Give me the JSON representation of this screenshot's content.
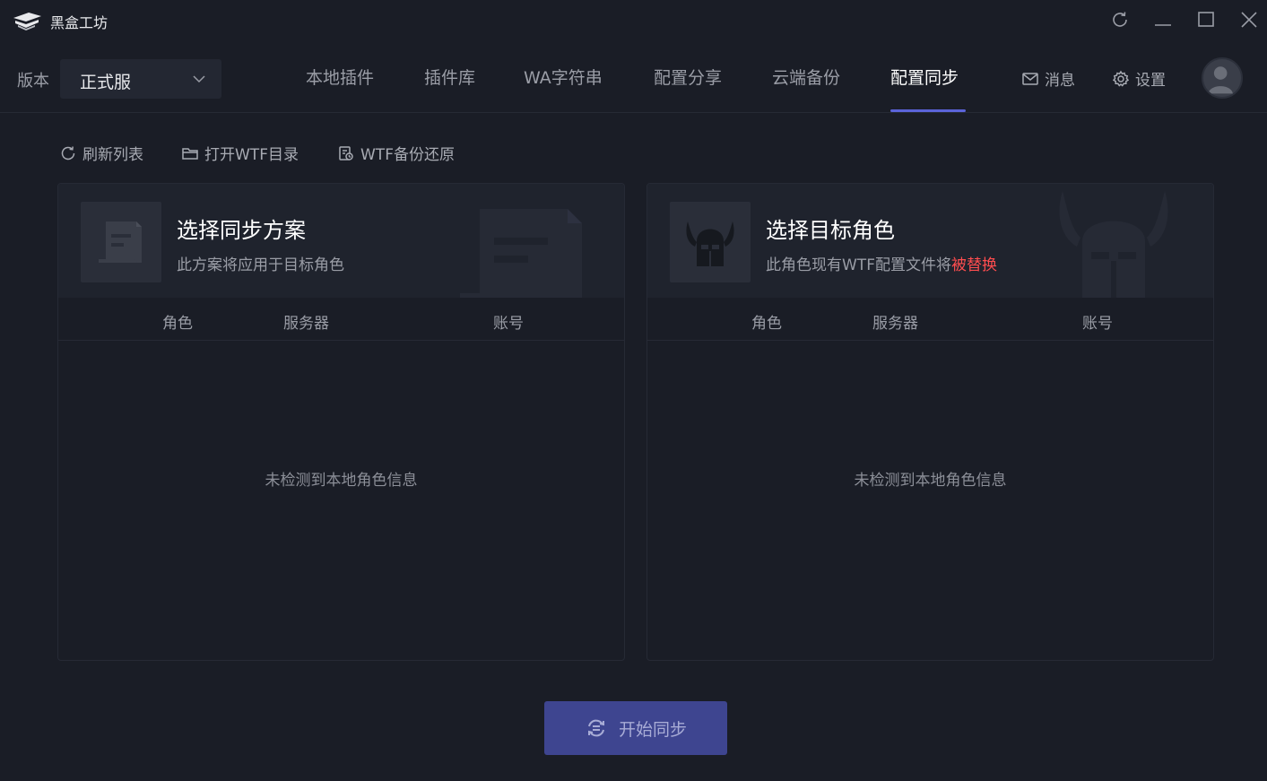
{
  "app": {
    "title": "黑盒工坊"
  },
  "window_controls": {
    "refresh_icon": "refresh-icon",
    "minimize_icon": "minimize-icon",
    "maximize_icon": "maximize-icon",
    "close_icon": "close-icon"
  },
  "header": {
    "version_label": "版本",
    "version_value": "正式服",
    "tabs": [
      {
        "label": "本地插件"
      },
      {
        "label": "插件库"
      },
      {
        "label": "WA字符串"
      },
      {
        "label": "配置分享"
      },
      {
        "label": "云端备份"
      },
      {
        "label": "配置同步",
        "active": true
      }
    ],
    "messages_label": "消息",
    "settings_label": "设置"
  },
  "toolbar": {
    "refresh_label": "刷新列表",
    "open_wtf_label": "打开WTF目录",
    "wtf_backup_label": "WTF备份还原"
  },
  "left_panel": {
    "title": "选择同步方案",
    "subtitle": "此方案将应用于目标角色",
    "columns": [
      "角色",
      "服务器",
      "账号"
    ],
    "empty_text": "未检测到本地角色信息"
  },
  "right_panel": {
    "title": "选择目标角色",
    "subtitle_prefix": "此角色现有WTF配置文件将",
    "subtitle_warn": "被替换",
    "columns": [
      "角色",
      "服务器",
      "账号"
    ],
    "empty_text": "未检测到本地角色信息"
  },
  "sync_button": {
    "label": "开始同步"
  },
  "colors": {
    "background": "#1a1d26",
    "accent": "#5b64d9",
    "button": "#3e4590",
    "warning": "#ff4d4f"
  }
}
